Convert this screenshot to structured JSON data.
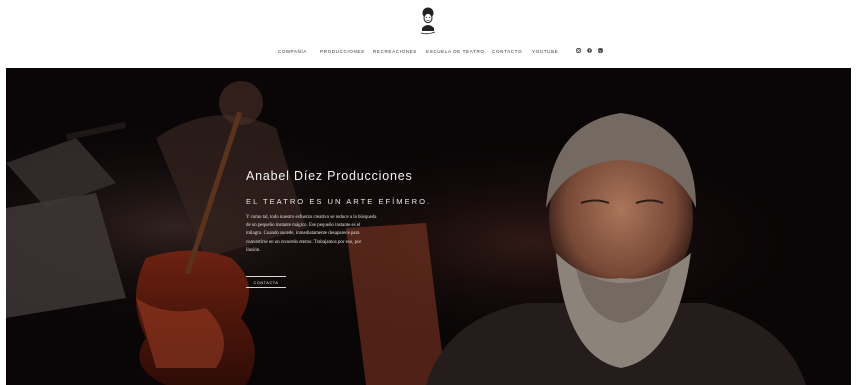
{
  "brand": {
    "logo": "anabel-diez-caricature-logo"
  },
  "nav": {
    "items": [
      {
        "label": "COMPAÑÍA"
      },
      {
        "label": "PRODUCCIONES"
      },
      {
        "label": "RECREACIONES"
      },
      {
        "label": "ESCUELA DE TEATRO"
      },
      {
        "label": "CONTACTO"
      },
      {
        "label": "YOUTUBE"
      }
    ],
    "social": [
      "instagram-icon",
      "facebook-icon",
      "vimeo-icon"
    ]
  },
  "hero": {
    "title": "Anabel Díez Producciones",
    "subtitle": "EL TEATRO ES UN ARTE EFÍMERO.",
    "text_lines": [
      "Y como tal, todo nuestro esfuerzo creativo se reduce a la búsqueda",
      "de un pequeño instante mágico. Ese pequeño instante es el",
      "milagro. Cuando sucede, inmediatamente desaparece para",
      "convertirse en un recuerdo eterno. Trabajamos por eso, por",
      "ilusión."
    ],
    "button_label": "CONTACTA",
    "image": "stage-photo-cellist-and-bearded-actor"
  },
  "colors": {
    "hero_bg": "#0c0708",
    "nav_text": "#333333",
    "hero_text": "#f2f2f2"
  }
}
